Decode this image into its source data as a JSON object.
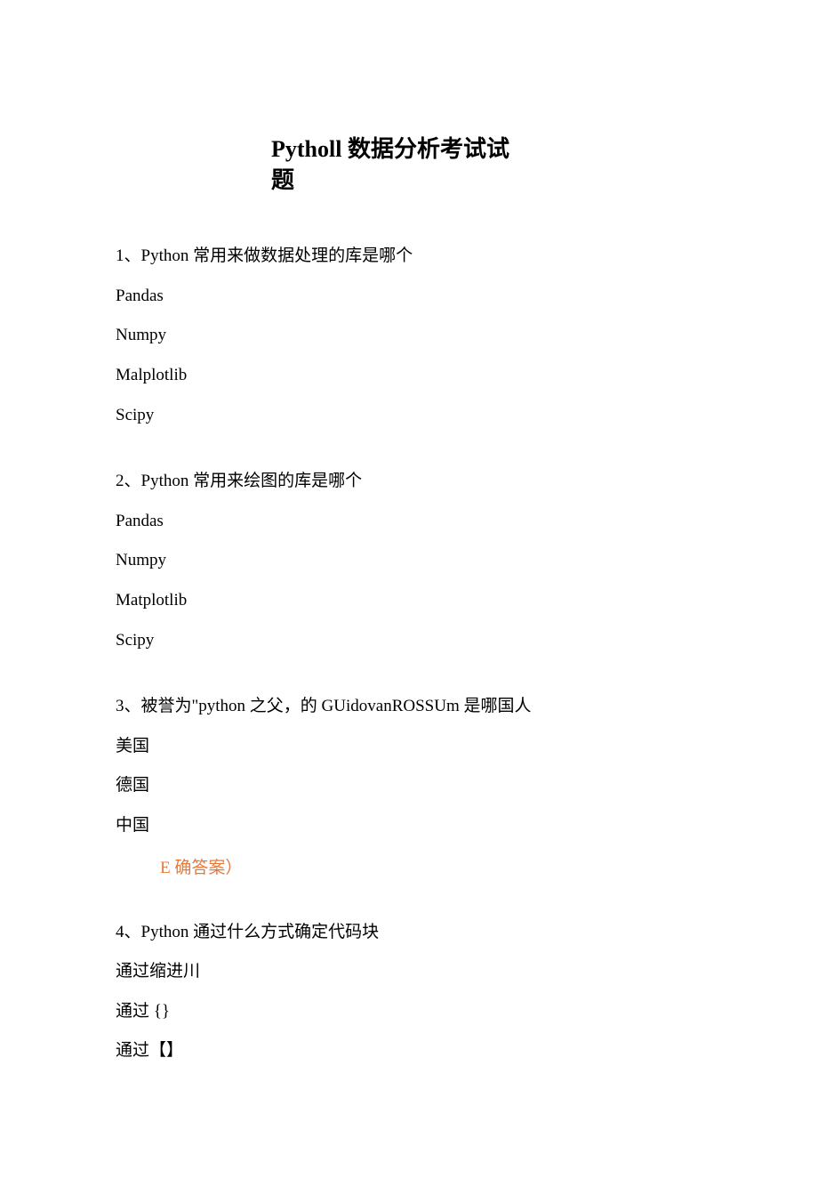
{
  "title_line1": "Pytholl 数据分析考试试",
  "title_line2": "题",
  "q1": {
    "prompt": "1、Python 常用来做数据处理的库是哪个",
    "opts": [
      "Pandas",
      "Numpy",
      "Malplotlib",
      "Scipy"
    ]
  },
  "q2": {
    "prompt": "2、Python 常用来绘图的库是哪个",
    "opts": [
      "Pandas",
      "Numpy",
      "Matplotlib",
      "Scipy"
    ]
  },
  "q3": {
    "prompt": "3、被誉为\"python 之父，的 GUidovanROSSUm 是哪国人",
    "opts": [
      "美国",
      "德国",
      "中国"
    ],
    "answer": "E 确答案）"
  },
  "q4": {
    "prompt": "4、Python 通过什么方式确定代码块",
    "opts": [
      "通过缩进川",
      "通过 {}",
      "通过【】"
    ]
  }
}
